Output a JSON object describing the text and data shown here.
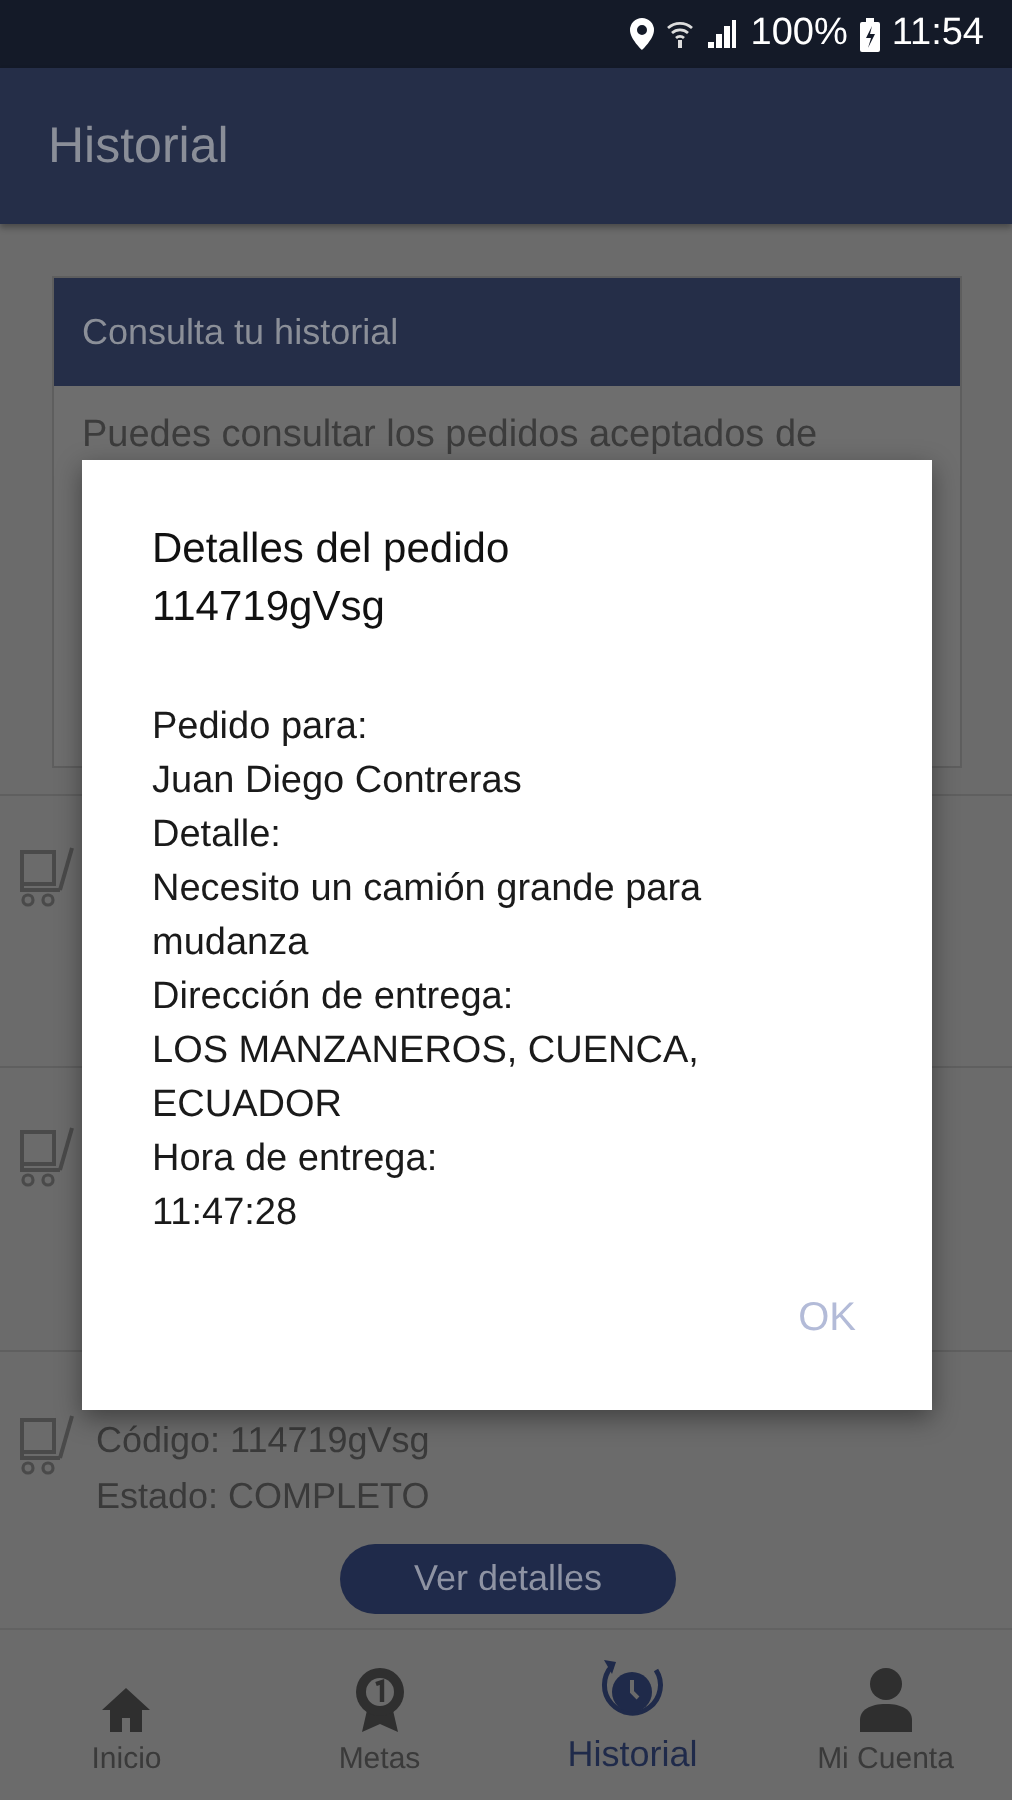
{
  "status_bar": {
    "battery": "100%",
    "time": "11:54"
  },
  "app_bar": {
    "title": "Historial"
  },
  "intro_card": {
    "title": "Consulta tu historial",
    "text": "Puedes consultar los pedidos aceptados de"
  },
  "order": {
    "code": "Código: 114719gVsg",
    "status": "Estado: COMPLETO",
    "button": "Ver detalles"
  },
  "dialog": {
    "title": "Detalles del pedido 114719gVsg",
    "lines": [
      "Pedido para:",
      "Juan Diego Contreras",
      "Detalle:",
      "Necesito un camión grande para mudanza",
      "Dirección de entrega:",
      "LOS MANZANEROS, CUENCA, ECUADOR",
      "Hora de entrega:",
      "11:47:28"
    ],
    "ok": "OK"
  },
  "bottom_nav": [
    {
      "kind": "home",
      "label": "Inicio",
      "selected": false
    },
    {
      "kind": "medal",
      "label": "Metas",
      "selected": false
    },
    {
      "kind": "history",
      "label": "Historial",
      "selected": true
    },
    {
      "kind": "account",
      "label": "Mi Cuenta",
      "selected": false
    }
  ]
}
